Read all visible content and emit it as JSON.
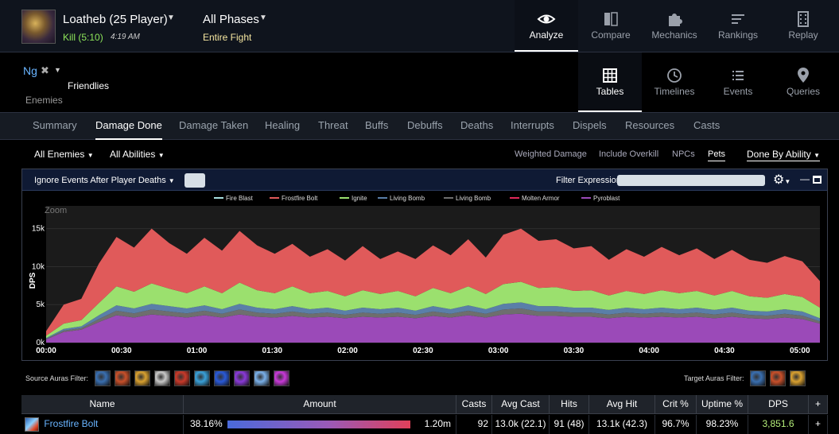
{
  "header": {
    "boss_name": "Loatheb (25 Player)",
    "kill_text": "Kill (5:10)",
    "kill_time": "4:19 AM",
    "phase": "All Phases",
    "phase_sub": "Entire Fight",
    "nav": [
      {
        "label": "Analyze",
        "icon": "eye-icon",
        "active": true
      },
      {
        "label": "Compare",
        "icon": "compare-icon",
        "active": false
      },
      {
        "label": "Mechanics",
        "icon": "puzzle-icon",
        "active": false
      },
      {
        "label": "Rankings",
        "icon": "rankings-icon",
        "active": false
      },
      {
        "label": "Replay",
        "icon": "film-icon",
        "active": false
      }
    ]
  },
  "selection": {
    "player": "Ng",
    "friendlies": "Friendlies",
    "enemies": "Enemies"
  },
  "views": [
    {
      "label": "Tables",
      "icon": "table-icon",
      "active": true
    },
    {
      "label": "Timelines",
      "icon": "clock-icon",
      "active": false
    },
    {
      "label": "Events",
      "icon": "list-icon",
      "active": false
    },
    {
      "label": "Queries",
      "icon": "map-pin-icon",
      "active": false
    }
  ],
  "report_tabs": [
    "Summary",
    "Damage Done",
    "Damage Taken",
    "Healing",
    "Threat",
    "Buffs",
    "Debuffs",
    "Deaths",
    "Interrupts",
    "Dispels",
    "Resources",
    "Casts"
  ],
  "active_report_tab": "Damage Done",
  "filters": {
    "enemies": "All Enemies",
    "abilities": "All Abilities",
    "options": [
      "Weighted Damage",
      "Include Overkill",
      "NPCs",
      "Pets"
    ],
    "active_option": "Pets",
    "done_by": "Done By Ability"
  },
  "chart_toolbar": {
    "ignore_events": "Ignore Events After Player Deaths",
    "filter_expression_label": "Filter Expression:"
  },
  "chart_data": {
    "type": "area",
    "zoom_label": "Zoom",
    "ylabel": "DPS",
    "y_ticks": [
      "0k",
      "5k",
      "10k",
      "15k"
    ],
    "ylim": [
      0,
      18000
    ],
    "x_ticks": [
      "00:00",
      "00:30",
      "01:00",
      "01:30",
      "02:00",
      "02:30",
      "03:00",
      "03:30",
      "04:00",
      "04:30",
      "05:00"
    ],
    "xlim": [
      0,
      308
    ],
    "legend_position": "top",
    "x": [
      0,
      7,
      14,
      21,
      28,
      35,
      42,
      49,
      56,
      63,
      70,
      77,
      84,
      91,
      98,
      105,
      112,
      119,
      126,
      133,
      140,
      147,
      154,
      161,
      168,
      175,
      182,
      189,
      196,
      203,
      210,
      217,
      224,
      231,
      238,
      245,
      252,
      259,
      266,
      273,
      280,
      287,
      294,
      301,
      308
    ],
    "series": [
      {
        "name": "Fire Blast",
        "color": "#a8e0e0",
        "values": [
          0,
          0,
          0,
          0,
          0,
          0,
          0,
          0,
          0,
          0,
          0,
          0,
          0,
          0,
          0,
          0,
          0,
          0,
          0,
          0,
          0,
          0,
          0,
          0,
          0,
          0,
          0,
          0,
          0,
          0,
          0,
          0,
          0,
          0,
          0,
          0,
          0,
          0,
          0,
          0,
          0,
          0,
          0,
          0,
          0
        ]
      },
      {
        "name": "Frostfire Bolt",
        "color": "#e05a5a",
        "values": [
          600,
          2500,
          2800,
          5200,
          6500,
          5800,
          7200,
          6000,
          5200,
          6400,
          5600,
          6800,
          5900,
          5200,
          5600,
          4800,
          5500,
          4700,
          5800,
          4600,
          5200,
          4900,
          5600,
          5000,
          6200,
          4800,
          6500,
          7000,
          6200,
          6300,
          5600,
          5800,
          4700,
          5500,
          4900,
          5700,
          5000,
          5600,
          4800,
          5400,
          4800,
          4600,
          5000,
          4700,
          3500
        ]
      },
      {
        "name": "Ignite",
        "color": "#9be06e",
        "values": [
          300,
          700,
          800,
          1600,
          2500,
          2200,
          2700,
          2300,
          2000,
          2500,
          2100,
          2800,
          2300,
          2100,
          2600,
          2100,
          2200,
          1900,
          2300,
          2000,
          2200,
          1900,
          2400,
          2100,
          2500,
          2000,
          2600,
          2700,
          2400,
          2500,
          2200,
          2300,
          1900,
          2200,
          2000,
          2300,
          2100,
          2200,
          1900,
          2200,
          1900,
          1800,
          2000,
          1900,
          1400
        ]
      },
      {
        "name": "Living Bomb",
        "color": "#5a7fa8",
        "values": [
          100,
          200,
          250,
          500,
          700,
          650,
          750,
          700,
          650,
          700,
          600,
          750,
          650,
          600,
          700,
          600,
          650,
          550,
          650,
          600,
          650,
          550,
          700,
          600,
          700,
          600,
          750,
          800,
          700,
          700,
          650,
          650,
          600,
          650,
          600,
          650,
          600,
          650,
          600,
          650,
          550,
          550,
          600,
          550,
          400
        ]
      },
      {
        "name": "Living Bomb",
        "color": "#6e6e6e",
        "values": [
          100,
          200,
          200,
          400,
          600,
          550,
          650,
          600,
          550,
          600,
          500,
          650,
          550,
          500,
          600,
          500,
          550,
          450,
          550,
          500,
          550,
          450,
          600,
          500,
          600,
          500,
          650,
          700,
          600,
          600,
          550,
          550,
          500,
          550,
          500,
          550,
          500,
          550,
          500,
          550,
          450,
          450,
          500,
          450,
          300
        ]
      },
      {
        "name": "Molten Armor",
        "color": "#e0285a",
        "values": [
          0,
          0,
          0,
          0,
          0,
          0,
          0,
          0,
          0,
          0,
          0,
          0,
          0,
          0,
          0,
          0,
          0,
          0,
          0,
          0,
          0,
          0,
          0,
          0,
          0,
          0,
          0,
          0,
          0,
          0,
          0,
          0,
          0,
          0,
          0,
          0,
          0,
          0,
          0,
          0,
          0,
          0,
          0,
          0,
          0
        ]
      },
      {
        "name": "Pyroblast",
        "color": "#9b4ab8",
        "values": [
          400,
          1400,
          1700,
          2700,
          3600,
          3300,
          3700,
          3500,
          3300,
          3600,
          3300,
          3700,
          3400,
          3300,
          3500,
          3300,
          3400,
          3200,
          3400,
          3300,
          3400,
          3200,
          3500,
          3300,
          3600,
          3300,
          3700,
          3800,
          3500,
          3500,
          3400,
          3400,
          3200,
          3400,
          3300,
          3400,
          3300,
          3400,
          3200,
          3400,
          3200,
          3100,
          3300,
          3100,
          2500
        ]
      }
    ]
  },
  "auras": {
    "source_label": "Source Auras Filter:",
    "source_icons": [
      "shatter-icon",
      "fire-icon",
      "orb-icon",
      "feather-icon",
      "flame-icon",
      "frost-icon",
      "rune-icon",
      "arcane-icon",
      "whirl-icon",
      "demon-icon"
    ],
    "target_label": "Target Auras Filter:",
    "target_icons": [
      "frostfire-icon",
      "fire-icon",
      "sunfire-icon"
    ]
  },
  "table": {
    "headers": [
      "Name",
      "Amount",
      "Casts",
      "Avg Cast",
      "Hits",
      "Avg Hit",
      "Crit %",
      "Uptime %",
      "DPS",
      "+"
    ],
    "rows": [
      {
        "name": "Frostfire Bolt",
        "percent": "38.16%",
        "percent_value": 38.16,
        "amount": "1.20m",
        "casts": "92",
        "avg_cast": "13.0k (22.1)",
        "hits": "91 (48)",
        "avg_hit": "13.1k (42.3)",
        "crit": "96.7%",
        "uptime": "98.23%",
        "dps": "3,851.6",
        "plus": "+"
      }
    ]
  }
}
